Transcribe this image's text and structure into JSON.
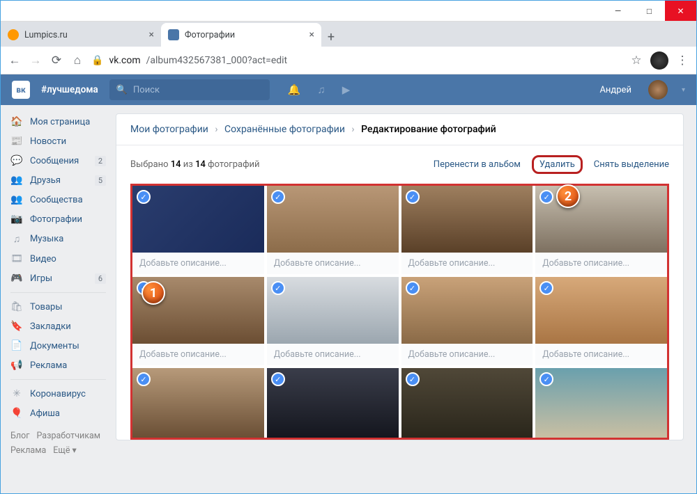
{
  "window": {
    "min": "—",
    "max": "□",
    "close": "✕"
  },
  "tabs": [
    {
      "title": "Lumpics.ru",
      "active": false
    },
    {
      "title": "Фотографии",
      "active": true
    }
  ],
  "newtab": "+",
  "urlbar": {
    "back": "←",
    "forward": "→",
    "reload": "⟳",
    "home": "⌂",
    "lock": "🔒",
    "host": "vk.com",
    "path": "/album432567381_000?act=edit",
    "star": "☆",
    "menu": "⋮"
  },
  "vkheader": {
    "logo": "вк",
    "hashtag": "#лучшедома",
    "search_placeholder": "Поиск",
    "icon_search": "🔍",
    "icon_bell": "🔔",
    "icon_music": "♫",
    "icon_play": "▶",
    "user": "Андрей",
    "chev": "▾"
  },
  "sidebar": {
    "items": [
      {
        "ico": "🏠",
        "label": "Моя страница"
      },
      {
        "ico": "📰",
        "label": "Новости"
      },
      {
        "ico": "💬",
        "label": "Сообщения",
        "badge": "2"
      },
      {
        "ico": "👥",
        "label": "Друзья",
        "badge": "5"
      },
      {
        "ico": "👥",
        "label": "Сообщества"
      },
      {
        "ico": "📷",
        "label": "Фотографии"
      },
      {
        "ico": "♫",
        "label": "Музыка"
      },
      {
        "ico": "🎞",
        "label": "Видео"
      },
      {
        "ico": "🎮",
        "label": "Игры",
        "badge": "6"
      }
    ],
    "items2": [
      {
        "ico": "🛍",
        "label": "Товары"
      },
      {
        "ico": "🔖",
        "label": "Закладки"
      },
      {
        "ico": "📄",
        "label": "Документы"
      },
      {
        "ico": "📢",
        "label": "Реклама"
      }
    ],
    "items3": [
      {
        "ico": "✳",
        "label": "Коронавирус"
      },
      {
        "ico": "🎈",
        "label": "Афиша"
      }
    ],
    "footer": {
      "a": "Блог",
      "b": "Разработчикам",
      "c": "Реклама",
      "d": "Ещё ▾"
    }
  },
  "breadcrumb": {
    "a": "Мои фотографии",
    "b": "Сохранённые фотографии",
    "c": "Редактирование фотографий",
    "sep": "›"
  },
  "selbar": {
    "prefix": "Выбрано ",
    "sel": "14",
    "of": " из ",
    "total": "14",
    "suffix": " фотографий",
    "move": "Перенести в альбом",
    "delete": "Удалить",
    "deselect": "Снять выделение"
  },
  "desc_placeholder": "Добавьте описание...",
  "check": "✓",
  "markers": {
    "m1": "1",
    "m2": "2"
  }
}
